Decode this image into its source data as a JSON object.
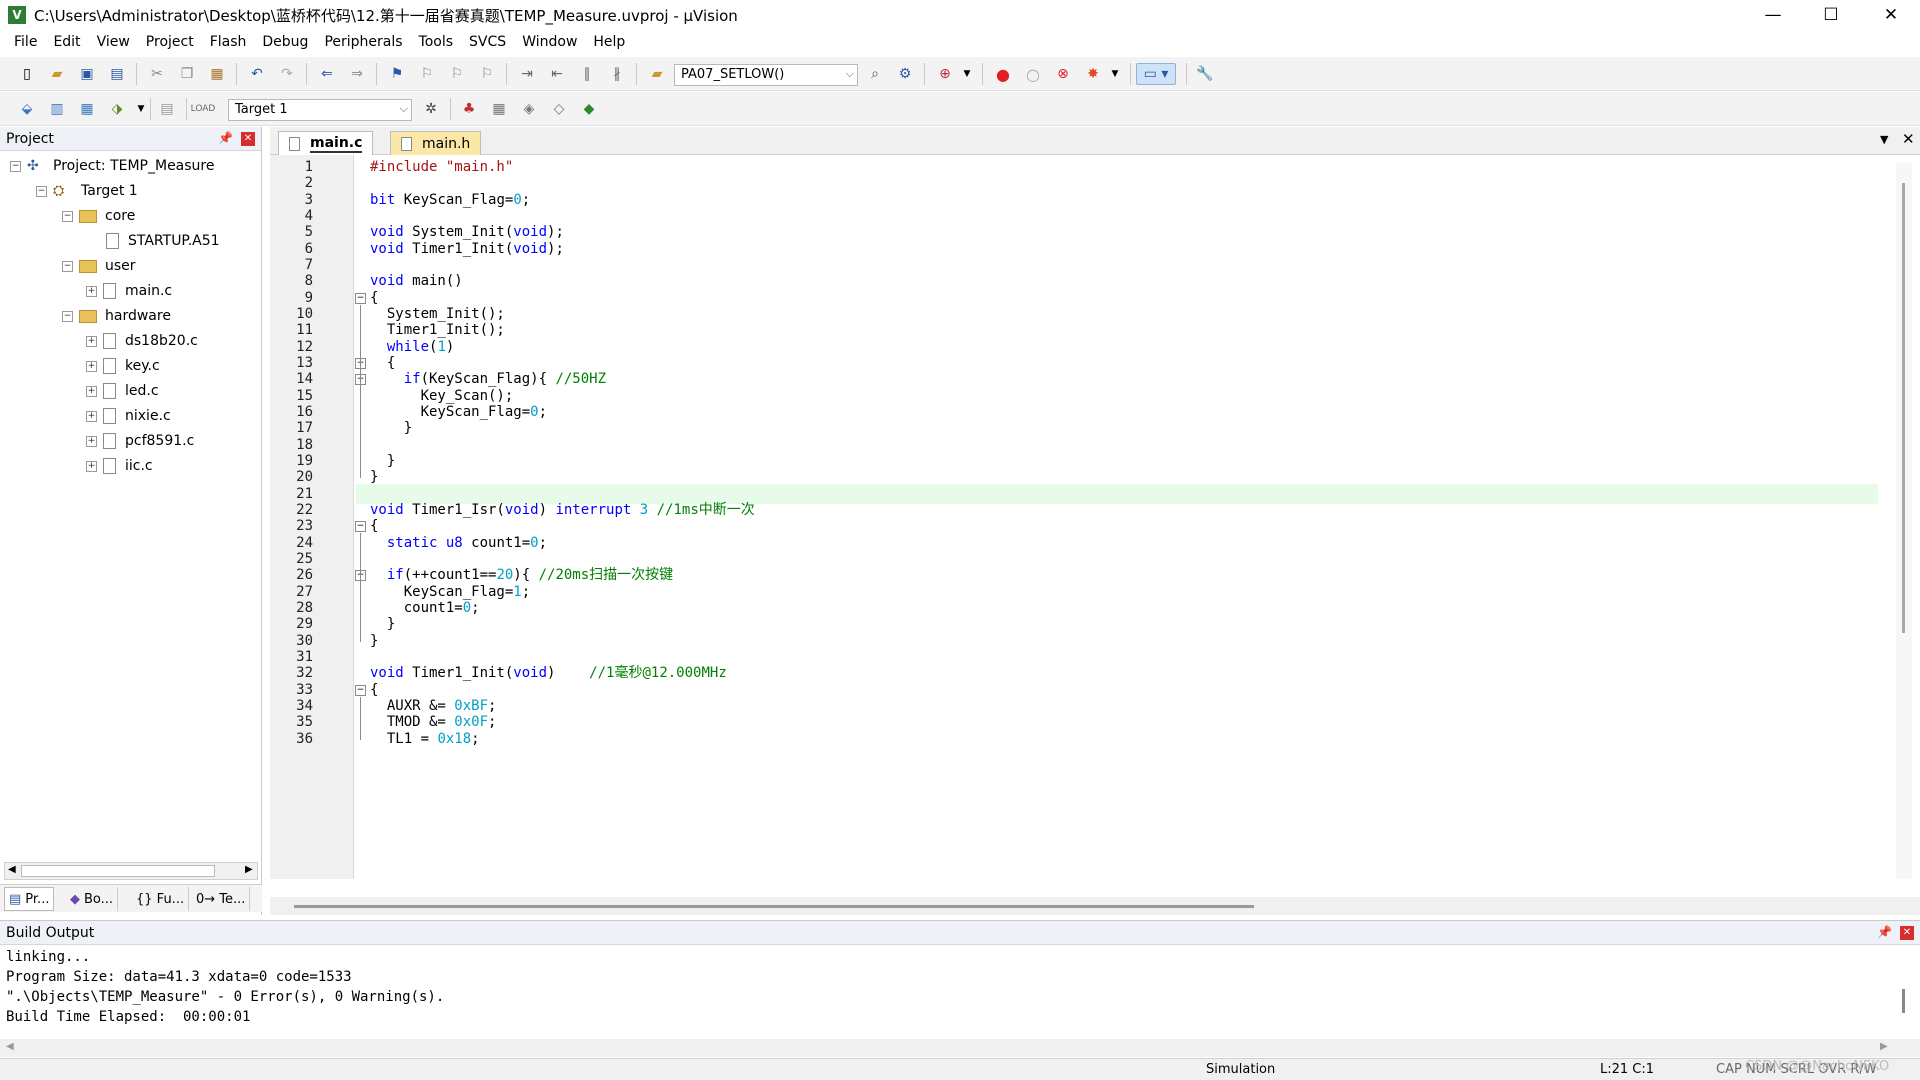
{
  "window": {
    "title": "C:\\Users\\Administrator\\Desktop\\蓝桥杯代码\\12.第十一届省赛真题\\TEMP_Measure.uvproj - µVision",
    "minimize": "—",
    "maximize": "☐",
    "close": "✕"
  },
  "menu": [
    "File",
    "Edit",
    "View",
    "Project",
    "Flash",
    "Debug",
    "Peripherals",
    "Tools",
    "SVCS",
    "Window",
    "Help"
  ],
  "toolbar": {
    "function_combo": "PA07_SETLOW()",
    "target_combo": "Target 1"
  },
  "project_panel": {
    "title": "Project",
    "tree": {
      "project": "Project: TEMP_Measure",
      "target": "Target 1",
      "groups": [
        {
          "name": "core",
          "files": [
            "STARTUP.A51"
          ]
        },
        {
          "name": "user",
          "files": [
            "main.c"
          ]
        },
        {
          "name": "hardware",
          "files": [
            "ds18b20.c",
            "key.c",
            "led.c",
            "nixie.c",
            "pcf8591.c",
            "iic.c"
          ]
        }
      ]
    },
    "bottom_tabs": [
      "Pr...",
      "Bo...",
      "{} Fu...",
      "0→ Te..."
    ]
  },
  "editor": {
    "tabs": [
      {
        "label": "main.c",
        "active": true
      },
      {
        "label": "main.h",
        "active": false
      }
    ],
    "current_line": 21,
    "lines": [
      "#include \"main.h\"",
      "",
      "bit KeyScan_Flag=0;",
      "",
      "void System_Init(void);",
      "void Timer1_Init(void);",
      "",
      "void main()",
      "{",
      "  System_Init();",
      "  Timer1_Init();",
      "  while(1)",
      "  {",
      "    if(KeyScan_Flag){ //50HZ",
      "      Key_Scan();",
      "      KeyScan_Flag=0;",
      "    }",
      "",
      "  }",
      "}",
      "",
      "void Timer1_Isr(void) interrupt 3 //1ms中断一次",
      "{",
      "  static u8 count1=0;",
      "",
      "  if(++count1==20){ //20ms扫描一次按键",
      "    KeyScan_Flag=1;",
      "    count1=0;",
      "  }",
      "}",
      "",
      "void Timer1_Init(void)    //1毫秒@12.000MHz",
      "{",
      "  AUXR &= 0xBF;",
      "  TMOD &= 0x0F;",
      "  TL1 = 0x18;"
    ]
  },
  "build_output": {
    "title": "Build Output",
    "lines": [
      "linking...",
      "Program Size: data=41.3 xdata=0 code=1533",
      "\".\\Objects\\TEMP_Measure\" - 0 Error(s), 0 Warning(s).",
      "Build Time Elapsed:  00:00:01"
    ]
  },
  "statusbar": {
    "mode": "Simulation",
    "position": "L:21 C:1",
    "indicators": "CAP  NUM  SCRL  OVR  R/W",
    "watermark": "CSDN @@NachoNEKO"
  },
  "colors": {
    "keyword": "#0000ff",
    "number": "#00a0c8",
    "string": "#a31515",
    "comment": "#008000",
    "current_line": "#e6fbe8"
  }
}
